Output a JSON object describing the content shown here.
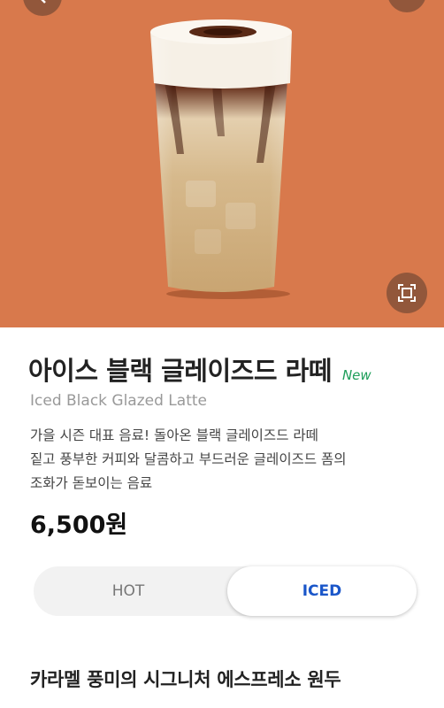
{
  "product": {
    "name_ko": "아이스 블랙 글레이즈드 라떼",
    "badge": "New",
    "name_en": "Iced Black Glazed Latte",
    "description_lines": [
      "가을 시즌 대표 음료! 돌아온 블랙 글레이즈드 라떼",
      "짙고 풍부한 커피와 달콤하고 부드러운 글레이즈드 폼의",
      "조화가 돋보이는 음료"
    ],
    "price": "6,500원"
  },
  "temperature_toggle": {
    "options": [
      "HOT",
      "ICED"
    ],
    "selected": "ICED"
  },
  "section": {
    "title": "카라멜 풍미의 시그니처 에스프레소 원두"
  },
  "colors": {
    "hero_background": "#d8794c",
    "new_badge": "#1e9e5a",
    "selected_option": "#1a56c9"
  },
  "icons": [
    "back-icon",
    "share-icon",
    "expand-icon"
  ]
}
